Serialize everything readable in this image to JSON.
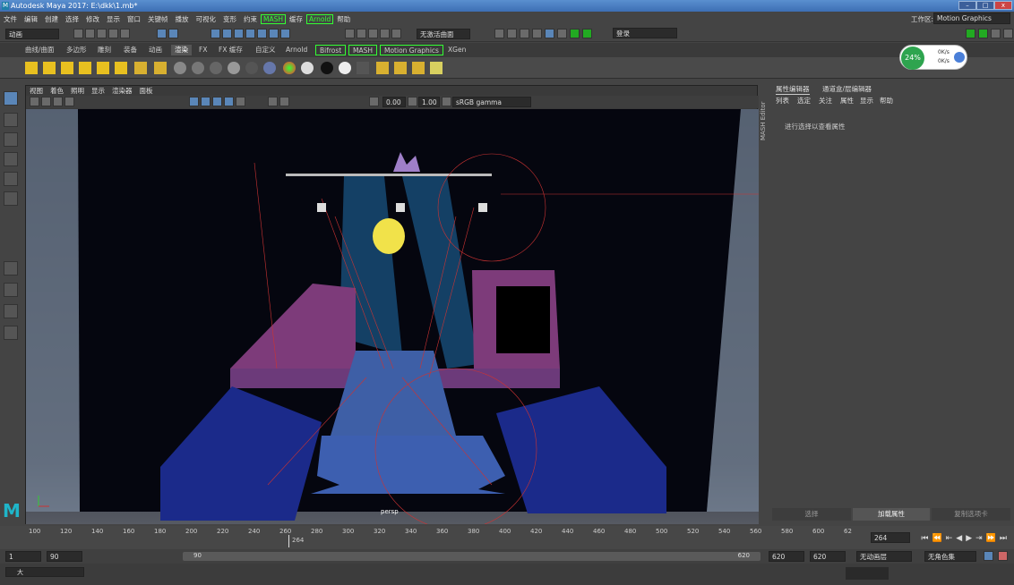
{
  "window": {
    "title": "Autodesk Maya 2017: E:\\dkk\\1.mb*"
  },
  "menubar": {
    "items": [
      "文件",
      "编辑",
      "创建",
      "选择",
      "修改",
      "显示",
      "窗口",
      "关键帧",
      "播放",
      "可视化",
      "变形",
      "约束"
    ],
    "highlight_items": [
      "MASH",
      "Arnold"
    ],
    "items_after": [
      "缓存",
      "帮助"
    ],
    "workspace_label": "工作区:",
    "workspace_value": "Motion Graphics"
  },
  "statusline": {
    "mode_value": "动画",
    "live_surface": "无激活曲面",
    "login": "登录"
  },
  "shelf_tabs": [
    "曲线/曲面",
    "多边形",
    "雕刻",
    "装备",
    "动画",
    "渲染",
    "FX",
    "FX 缓存",
    "自定义",
    "Arnold",
    "Bifrost",
    "MASH",
    "Motion Graphics",
    "XGen"
  ],
  "shelf_active": "渲染",
  "perf_gauge": {
    "percent": "24%",
    "up": "0K/s",
    "down": "0K/s"
  },
  "viewport": {
    "menu": [
      "视图",
      "着色",
      "照明",
      "显示",
      "渲染器",
      "面板"
    ],
    "exposure": "0.00",
    "gamma": "1.00",
    "color_space": "sRGB gamma",
    "camera_label": "persp"
  },
  "attr_editor": {
    "tab1": "属性编辑器",
    "tab2": "通道盒/层编辑器",
    "submenu": [
      "列表",
      "选定",
      "关注",
      "属性",
      "显示",
      "帮助"
    ],
    "message": "进行选择以查看属性",
    "btn_select": "选择",
    "btn_load": "加载属性",
    "btn_copy": "复制选项卡",
    "side_tab": "MASH Editor"
  },
  "timeline": {
    "ticks": [
      "100",
      "120",
      "140",
      "160",
      "180",
      "200",
      "220",
      "240",
      "260",
      "280",
      "300",
      "320",
      "340",
      "360",
      "380",
      "400",
      "420",
      "440",
      "460",
      "480",
      "500",
      "520",
      "540",
      "560",
      "580",
      "600",
      "62"
    ],
    "current_marker": "264",
    "current_frame": "264"
  },
  "range": {
    "start": "1",
    "start2": "90",
    "slider_start": "90",
    "slider_end": "620",
    "end1": "620",
    "end2": "620",
    "anim_layer": "无动画层",
    "char_set": "无角色集"
  },
  "cmdline": {
    "label": "大"
  }
}
